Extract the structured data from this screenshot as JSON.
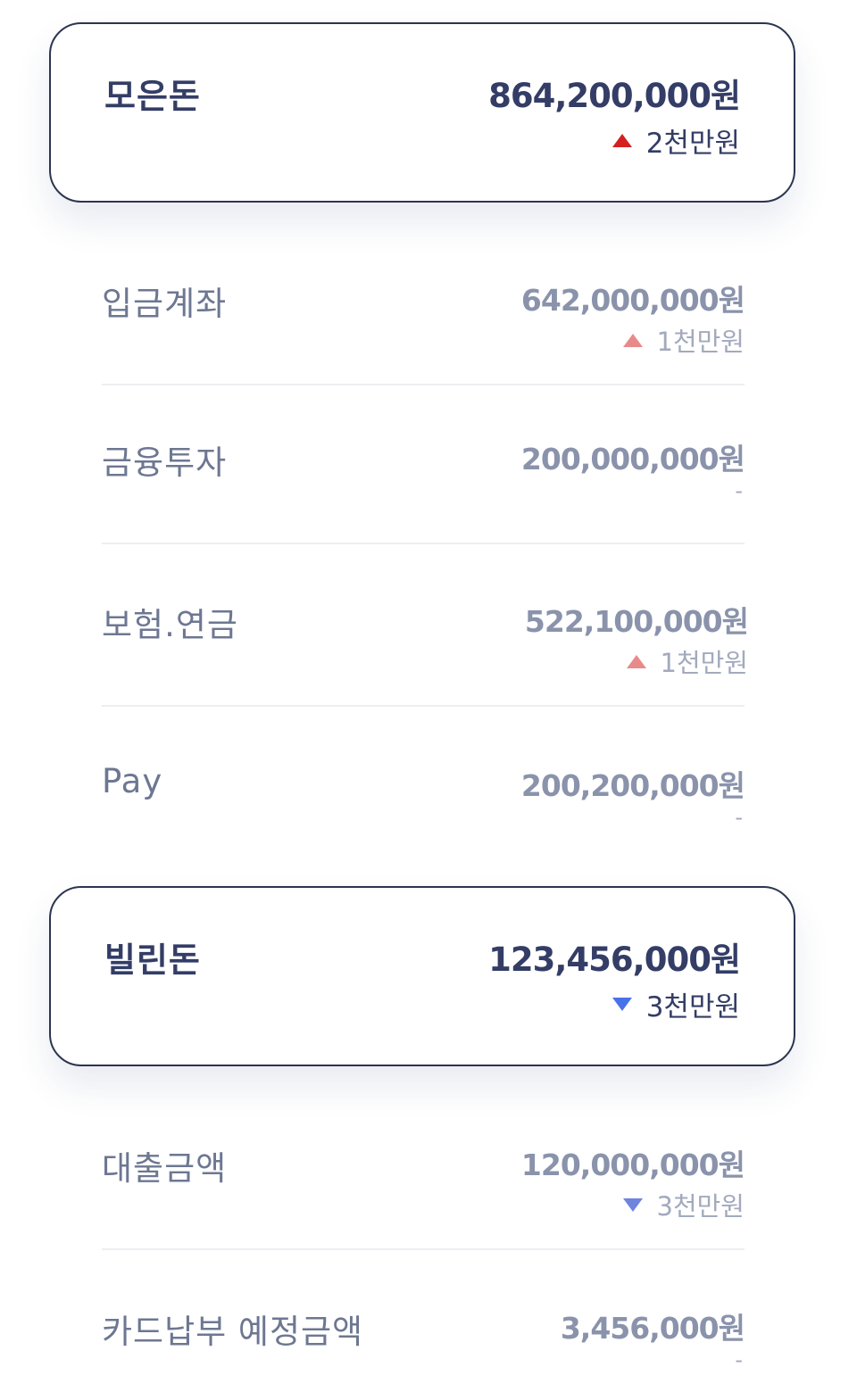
{
  "assets": {
    "title": "모은돈",
    "amount": "864,200,000원",
    "change": "2천만원",
    "change_direction": "up",
    "items": [
      {
        "label": "입금계좌",
        "amount": "642,000,000원",
        "change": "1천만원",
        "change_direction": "up"
      },
      {
        "label": "금융투자",
        "amount": "200,000,000원",
        "change": "-",
        "change_direction": "none"
      },
      {
        "label": "보험.연금",
        "amount": "522,100,000원",
        "change": "1천만원",
        "change_direction": "up"
      },
      {
        "label": "Pay",
        "amount": "200,200,000원",
        "change": "-",
        "change_direction": "none"
      }
    ]
  },
  "debts": {
    "title": "빌린돈",
    "amount": "123,456,000원",
    "change": "3천만원",
    "change_direction": "down",
    "items": [
      {
        "label": "대출금액",
        "amount": "120,000,000원",
        "change": "3천만원",
        "change_direction": "down"
      },
      {
        "label": "카드납부 예정금액",
        "amount": "3,456,000원",
        "change": "-",
        "change_direction": "none"
      }
    ]
  },
  "colors": {
    "increase": "#d42020",
    "increase_light": "#e98a8a",
    "decrease": "#4a72e8",
    "decrease_light": "#6f84dd",
    "text_primary": "#333d66",
    "text_secondary": "#8a93ab"
  },
  "icons": {
    "increase": "triangle-up-icon",
    "decrease": "triangle-down-icon"
  }
}
